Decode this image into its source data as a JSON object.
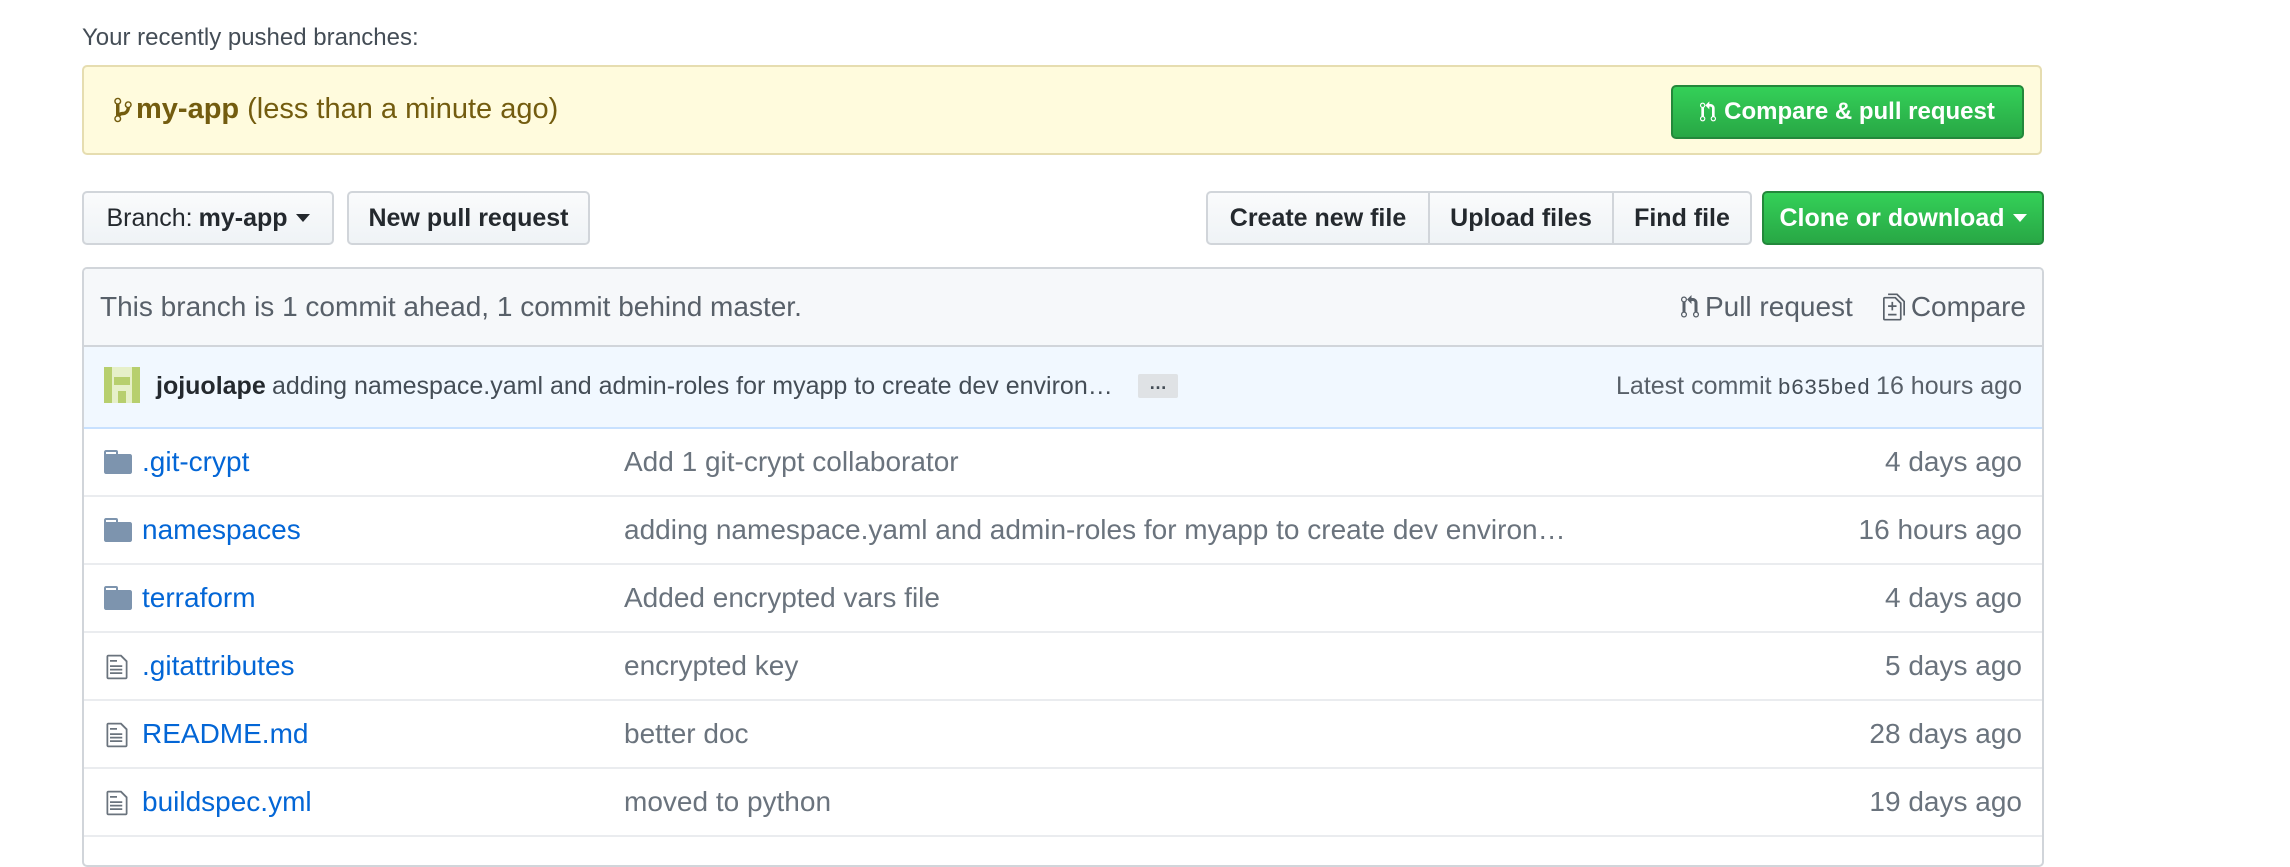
{
  "recent": {
    "title": "Your recently pushed branches:",
    "branch": "my-app",
    "time": "(less than a minute ago)",
    "compare_button": "Compare & pull request"
  },
  "toolbar": {
    "branch_prefix": "Branch:",
    "branch_name": "my-app",
    "new_pr": "New pull request",
    "create_file": "Create new file",
    "upload_files": "Upload files",
    "find_file": "Find file",
    "clone": "Clone or download"
  },
  "branch_info": {
    "text": "This branch is 1 commit ahead, 1 commit behind master.",
    "pull_request": "Pull request",
    "compare": "Compare"
  },
  "commit": {
    "author": "jojuolape",
    "message": "adding namespace.yaml and admin-roles for myapp to create dev environ…",
    "ellipsis": "…",
    "latest_label": "Latest commit",
    "sha": "b635bed",
    "age": "16 hours ago"
  },
  "files": [
    {
      "type": "folder",
      "name": ".git-crypt",
      "message": "Add 1 git-crypt collaborator",
      "age": "4 days ago"
    },
    {
      "type": "folder",
      "name": "namespaces",
      "message": "adding namespace.yaml and admin-roles for myapp to create dev environ…",
      "age": "16 hours ago"
    },
    {
      "type": "folder",
      "name": "terraform",
      "message": "Added encrypted vars file",
      "age": "4 days ago"
    },
    {
      "type": "file",
      "name": ".gitattributes",
      "message": "encrypted key",
      "age": "5 days ago"
    },
    {
      "type": "file",
      "name": "README.md",
      "message": "better doc",
      "age": "28 days ago"
    },
    {
      "type": "file",
      "name": "buildspec.yml",
      "message": "moved to python",
      "age": "19 days ago"
    }
  ],
  "colors": {
    "link": "#0366d6",
    "green": "#28a745",
    "banner_bg": "#fffbdd",
    "icon_gray": "#7d94ae"
  }
}
